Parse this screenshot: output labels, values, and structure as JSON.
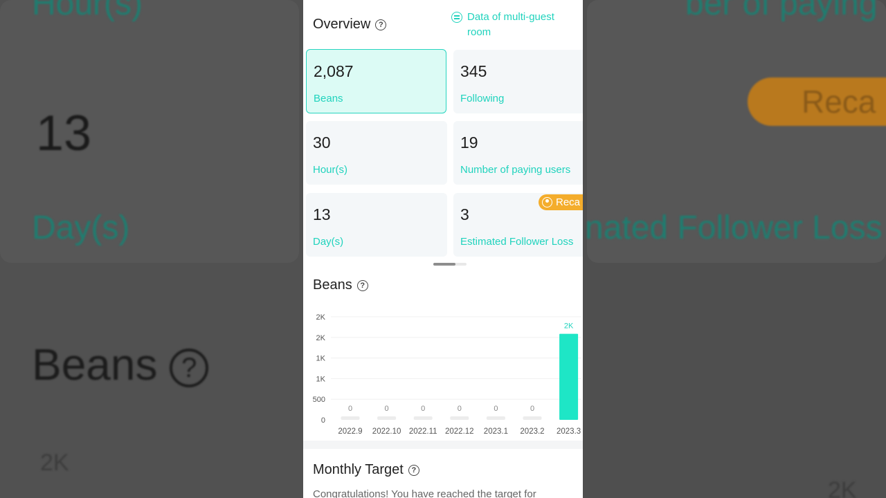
{
  "background": {
    "top_left_text": "Hour(s)",
    "top_right_text": "ber of paying users",
    "big_number": "13",
    "day_text": "Day(s)",
    "recall_text": "Reca",
    "follower_text": "nated Follower Loss",
    "beans_text": "Beans",
    "small_2k_left": "2K",
    "small_2k_right": "2K"
  },
  "overview": {
    "title": "Overview",
    "multi_guest_label": "Data of multi-guest room",
    "cards": [
      {
        "value": "2,087",
        "label": "Beans"
      },
      {
        "value": "345",
        "label": "Following"
      },
      {
        "value": "30",
        "label": "Hour(s)"
      },
      {
        "value": "19",
        "label": "Number of paying users"
      },
      {
        "value": "13",
        "label": "Day(s)"
      },
      {
        "value": "3",
        "label": "Estimated Follower Loss"
      }
    ],
    "recall_badge": "Reca"
  },
  "beans_section": {
    "title": "Beans"
  },
  "chart_data": {
    "type": "bar",
    "categories": [
      "2022.9",
      "2022.10",
      "2022.11",
      "2022.12",
      "2023.1",
      "2023.2",
      "2023.3"
    ],
    "values": [
      0,
      0,
      0,
      0,
      0,
      0,
      2087
    ],
    "data_labels": [
      "0",
      "0",
      "0",
      "0",
      "0",
      "0",
      "2K"
    ],
    "y_ticks": [
      "0",
      "500",
      "1K",
      "1K",
      "2K",
      "2K"
    ],
    "ylim": [
      0,
      2500
    ],
    "grid": true,
    "bar_color": "#1ee6c6",
    "empty_bar_color": "#ececec"
  },
  "monthly_target": {
    "title": "Monthly Target",
    "text": "Congratulations! You have reached the target for"
  },
  "colors": {
    "accent": "#20d3bd",
    "recall": "#f4ad2c"
  }
}
